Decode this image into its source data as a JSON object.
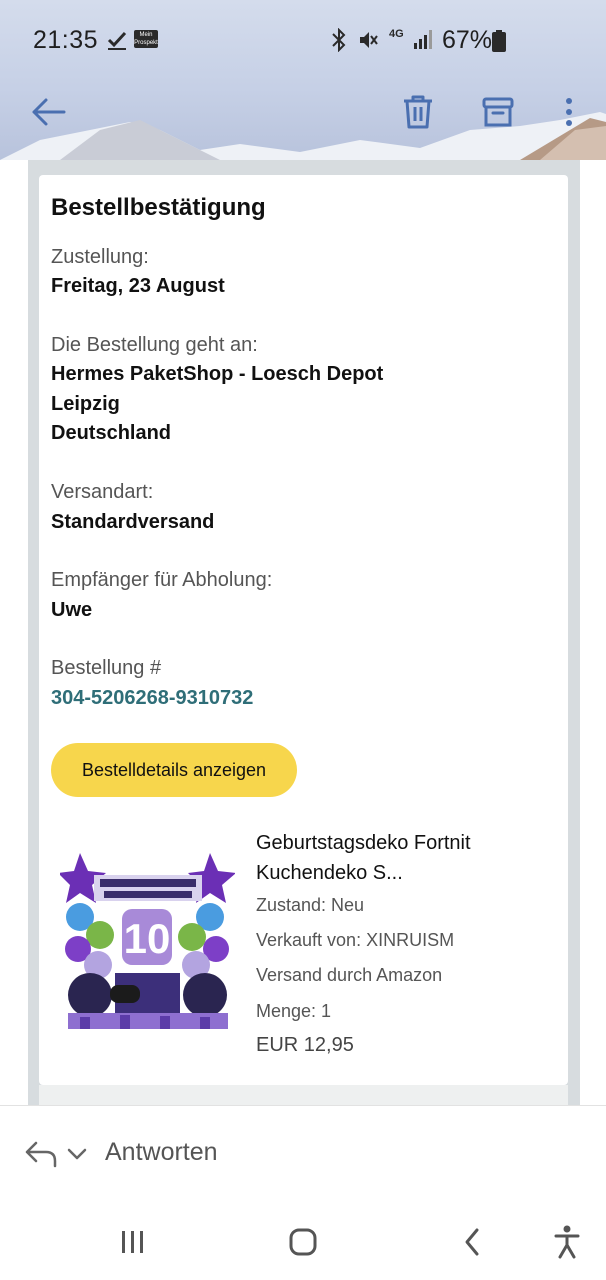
{
  "status_bar": {
    "time": "21:35",
    "notification_label": "Mein Prospekt",
    "network": "4G",
    "battery": "67%"
  },
  "toolbar": {
    "back_icon": "arrow-left-icon",
    "delete_icon": "trash-icon",
    "archive_icon": "archive-icon",
    "more_icon": "more-vert-icon",
    "accent_color": "#4a6fb0"
  },
  "email": {
    "title": "Bestellbestätigung",
    "delivery_label": "Zustellung:",
    "delivery_value": "Freitag, 23 August",
    "ship_to_label": "Die Bestellung geht an:",
    "ship_to_lines": [
      "Hermes PaketShop - Loesch Depot",
      "Leipzig",
      "Deutschland"
    ],
    "shipping_method_label": "Versandart:",
    "shipping_method_value": "Standardversand",
    "recipient_label": "Empfänger für Abholung:",
    "recipient_value": "Uwe",
    "order_label": "Bestellung #",
    "order_number": "304-5206268-9310732",
    "details_button": "Bestelldetails anzeigen",
    "link_color": "#2f6e78",
    "button_color": "#f7d64c"
  },
  "product": {
    "title": "Geburtstagsdeko Fortnit Kuchendeko S...",
    "condition": "Zustand: Neu",
    "seller": "Verkauft von: XINRUISM",
    "fulfillment": "Versand durch Amazon",
    "quantity": "Menge: 1",
    "price": "EUR 12,95",
    "image_number": "10"
  },
  "reply_bar": {
    "label": "Antworten"
  },
  "nav": {
    "recents_icon": "recents-icon",
    "home_icon": "home-icon",
    "back_icon": "back-icon",
    "accessibility_icon": "accessibility-icon"
  }
}
